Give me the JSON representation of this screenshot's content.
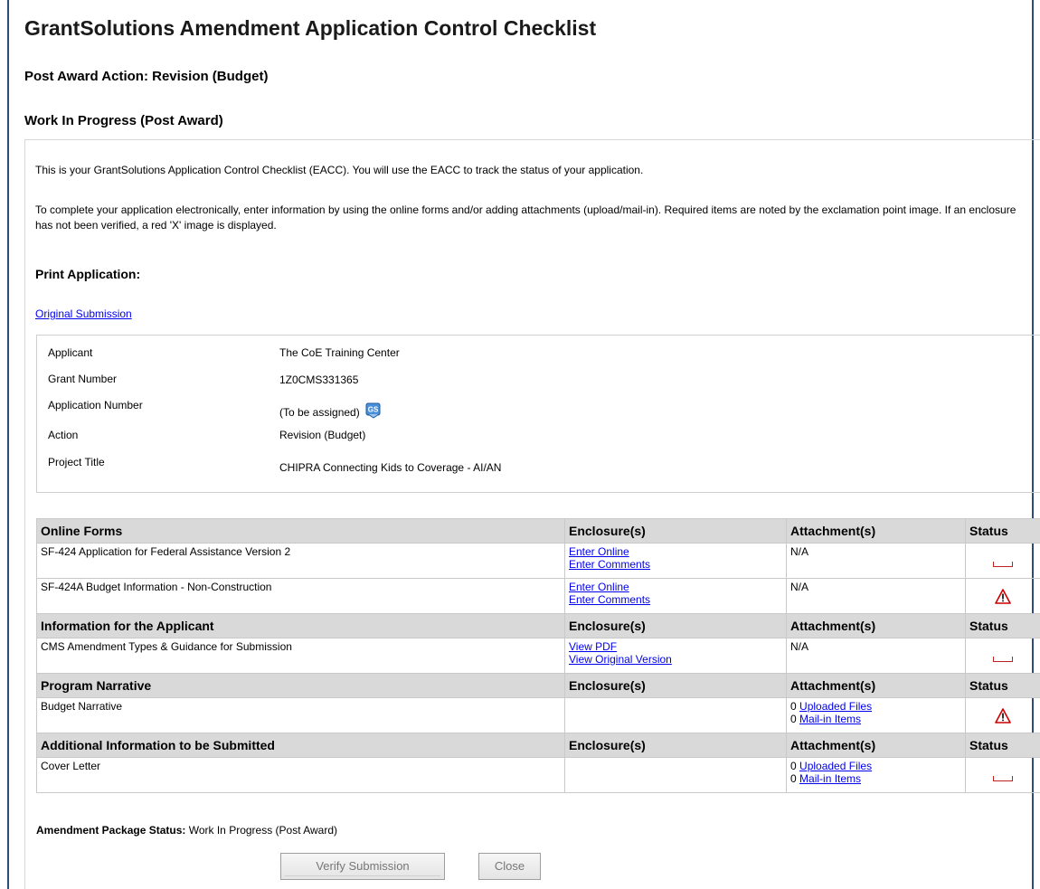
{
  "header": {
    "title": "GrantSolutions Amendment Application Control Checklist",
    "post_award_action": "Post Award Action: Revision (Budget)",
    "work_status": "Work In Progress (Post Award)"
  },
  "intro": {
    "p1": "This is your GrantSolutions Application Control Checklist (EACC). You will use the EACC to track the status of your application.",
    "p2": "To complete your application electronically, enter information by using the online forms and/or adding attachments (upload/mail-in).  Required items are noted by the exclamation point image.  If an enclosure has not been verified, a red 'X' image is displayed."
  },
  "print": {
    "heading": "Print Application:",
    "original_link": "Original Submission"
  },
  "info": {
    "applicant_label": "Applicant",
    "applicant_value": "The CoE Training Center",
    "grant_label": "Grant Number",
    "grant_value": "1Z0CMS331365",
    "appnum_label": "Application Number",
    "appnum_value": "(To be assigned)",
    "action_label": "Action",
    "action_value": "Revision (Budget)",
    "title_label": "Project Title",
    "title_value": "CHIPRA Connecting Kids to Coverage - AI/AN"
  },
  "columns": {
    "enclosures": "Enclosure(s)",
    "attachments": "Attachment(s)",
    "status": "Status"
  },
  "sections": [
    {
      "heading": "Online Forms",
      "rows": [
        {
          "name": "SF-424 Application for Federal Assistance Version 2",
          "links": [
            "Enter Online",
            "Enter Comments"
          ],
          "attachment": "N/A",
          "status": "empty"
        },
        {
          "name": "SF-424A Budget Information - Non-Construction",
          "links": [
            "Enter Online",
            "Enter Comments"
          ],
          "attachment": "N/A",
          "status": "warning"
        }
      ]
    },
    {
      "heading": "Information for the Applicant",
      "rows": [
        {
          "name": "CMS Amendment Types & Guidance for Submission",
          "links": [
            "View PDF",
            "View Original Version"
          ],
          "attachment": "N/A",
          "status": "empty"
        }
      ]
    },
    {
      "heading": "Program Narrative",
      "rows": [
        {
          "name": "Budget Narrative",
          "uploaded_count": "0",
          "uploaded_label": "Uploaded Files",
          "mailin_count": "0",
          "mailin_label": "Mail-in Items",
          "status": "warning"
        }
      ]
    },
    {
      "heading": "Additional Information to be Submitted",
      "rows": [
        {
          "name": "Cover Letter",
          "uploaded_count": "0",
          "uploaded_label": "Uploaded Files",
          "mailin_count": "0",
          "mailin_label": "Mail-in Items",
          "status": "empty"
        }
      ]
    }
  ],
  "footer": {
    "status_label": "Amendment Package Status:",
    "status_value": "Work In Progress (Post Award)",
    "verify_button": "Verify Submission",
    "close_button": "Close"
  },
  "colors": {
    "frame": "#2e4a7a",
    "link": "#0000ee",
    "header_bg": "#d9d9d9",
    "warning": "#cc0000"
  }
}
